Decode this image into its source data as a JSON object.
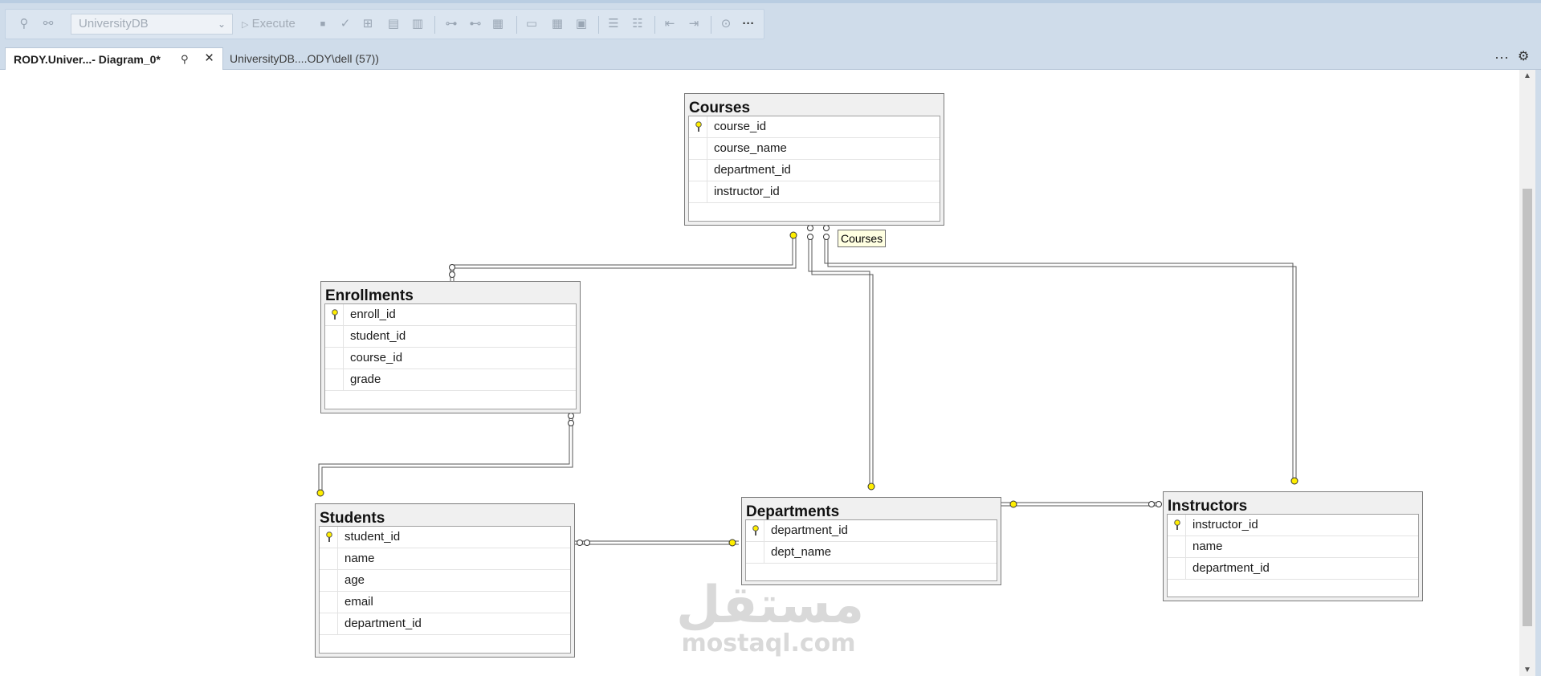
{
  "toolbar": {
    "database_select": "UniversityDB",
    "execute_label": "Execute",
    "more_label": "···"
  },
  "tabs": [
    {
      "label": "RODY.Univer...- Diagram_0*",
      "active": true
    },
    {
      "label": "UniversityDB....ODY\\dell (57))",
      "active": false
    }
  ],
  "tabbar": {
    "overflow_label": "···",
    "settings_icon": "gear-icon"
  },
  "diagram": {
    "tables": {
      "courses": {
        "title": "Courses",
        "columns": [
          {
            "name": "course_id",
            "pk": true
          },
          {
            "name": "course_name",
            "pk": false
          },
          {
            "name": "department_id",
            "pk": false
          },
          {
            "name": "instructor_id",
            "pk": false
          }
        ]
      },
      "enrollments": {
        "title": "Enrollments",
        "columns": [
          {
            "name": "enroll_id",
            "pk": true
          },
          {
            "name": "student_id",
            "pk": false
          },
          {
            "name": "course_id",
            "pk": false
          },
          {
            "name": "grade",
            "pk": false
          }
        ]
      },
      "students": {
        "title": "Students",
        "columns": [
          {
            "name": "student_id",
            "pk": true
          },
          {
            "name": "name",
            "pk": false
          },
          {
            "name": "age",
            "pk": false
          },
          {
            "name": "email",
            "pk": false
          },
          {
            "name": "department_id",
            "pk": false
          }
        ]
      },
      "departments": {
        "title": "Departments",
        "columns": [
          {
            "name": "department_id",
            "pk": true
          },
          {
            "name": "dept_name",
            "pk": false
          }
        ]
      },
      "instructors": {
        "title": "Instructors",
        "columns": [
          {
            "name": "instructor_id",
            "pk": true
          },
          {
            "name": "name",
            "pk": false
          },
          {
            "name": "department_id",
            "pk": false
          }
        ]
      }
    },
    "tooltip": "Courses",
    "key_color": "#ffee00"
  },
  "watermark": {
    "arabic": "مستقل",
    "latin": "mostaql.com"
  }
}
